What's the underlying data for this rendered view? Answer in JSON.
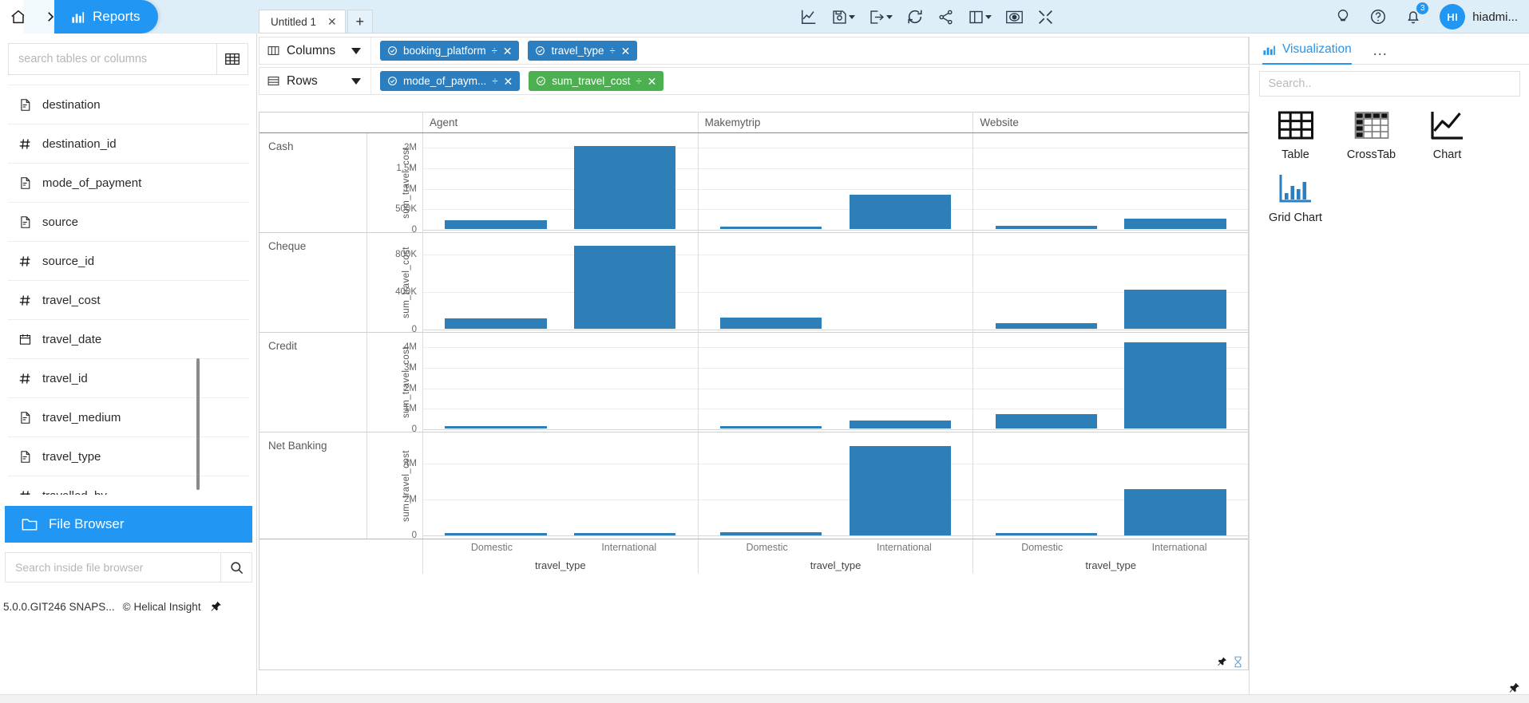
{
  "breadcrumb": {
    "home_icon": "home-icon",
    "separator": "chevron-right-icon",
    "active_icon": "bar-chart-icon",
    "active_label": "Reports"
  },
  "tabs": {
    "items": [
      {
        "label": "Untitled 1",
        "close": "✕"
      }
    ],
    "add_label": "+"
  },
  "toolbar": {
    "mid_icons": [
      {
        "name": "line-chart-icon",
        "caret": false
      },
      {
        "name": "save-icon",
        "caret": true
      },
      {
        "name": "export-icon",
        "caret": true
      },
      {
        "name": "refresh-icon",
        "caret": false
      },
      {
        "name": "share-icon",
        "caret": false
      },
      {
        "name": "layout-panel-icon",
        "caret": true
      },
      {
        "name": "preview-eye-icon",
        "caret": false
      },
      {
        "name": "fullscreen-icon",
        "caret": false
      }
    ],
    "lightbulb": "lightbulb-icon",
    "help": "help-icon",
    "bell": "bell-icon",
    "bell_badge": "3",
    "avatar_initials": "HI",
    "username": "hiadmi..."
  },
  "sidebar": {
    "search_placeholder": "search tables or columns",
    "grid_toggle_icon": "table-grid-icon",
    "fields": [
      {
        "label": "destination",
        "type": "text"
      },
      {
        "label": "destination_id",
        "type": "number"
      },
      {
        "label": "mode_of_payment",
        "type": "text"
      },
      {
        "label": "source",
        "type": "text"
      },
      {
        "label": "source_id",
        "type": "number"
      },
      {
        "label": "travel_cost",
        "type": "number"
      },
      {
        "label": "travel_date",
        "type": "date"
      },
      {
        "label": "travel_id",
        "type": "number"
      },
      {
        "label": "travel_medium",
        "type": "text"
      },
      {
        "label": "travel_type",
        "type": "text"
      },
      {
        "label": "travelled_by",
        "type": "number"
      }
    ],
    "file_browser_label": "File Browser",
    "file_browser_icon": "folder-icon",
    "fb_search_placeholder": "Search inside file browser",
    "fb_search_icon": "search-icon",
    "footer_version": "5.0.0.GIT246 SNAPS...",
    "footer_copyright": "Helical Insight",
    "footer_copyright_mark": "©",
    "footer_pin_icon": "pin-icon"
  },
  "shelves": [
    {
      "name": "columns-shelf",
      "icon": "columns-icon",
      "title": "Columns",
      "pills": [
        {
          "label": "booking_platform",
          "color": "blue"
        },
        {
          "label": "travel_type",
          "color": "blue"
        }
      ]
    },
    {
      "name": "rows-shelf",
      "icon": "rows-icon",
      "title": "Rows",
      "pills": [
        {
          "label": "mode_of_paym...",
          "color": "blue"
        },
        {
          "label": "sum_travel_cost",
          "color": "green"
        }
      ]
    }
  ],
  "pill_icons": {
    "check": "check-circle-icon",
    "sort": "÷",
    "close": "✕"
  },
  "right_panel": {
    "tab_label": "Visualization",
    "tab_icon": "chart-icon",
    "more_icon": "…",
    "search_placeholder": "Search..",
    "items": [
      {
        "label": "Table",
        "icon": "table-icon",
        "selected": false
      },
      {
        "label": "CrossTab",
        "icon": "crosstab-icon",
        "selected": false
      },
      {
        "label": "Chart",
        "icon": "line-chart-icon",
        "selected": false
      },
      {
        "label": "Grid Chart",
        "icon": "grid-chart-icon",
        "selected": true
      }
    ],
    "pin_icon": "pin-icon"
  },
  "chart_corner": {
    "pin_icon": "pin-icon",
    "loading_icon": "hourglass-icon"
  },
  "chart_data": {
    "type": "bar",
    "title": "",
    "layout": "small-multiples grid: rows = mode_of_payment, columns = booking_platform",
    "xlabel": "travel_type",
    "ylabel": "sum_travel_cost",
    "grid": true,
    "legend": "none",
    "bar_color": "#2e7fb8",
    "row_field": "mode_of_payment",
    "column_field": "booking_platform",
    "columns": [
      "Agent",
      "Makemytrip",
      "Website"
    ],
    "categories": [
      "Domestic",
      "International"
    ],
    "rows": [
      {
        "label": "Cash",
        "ylim": [
          0,
          2200000
        ],
        "yticks": [
          0,
          500000,
          1000000,
          1500000,
          2000000
        ],
        "ytick_labels": [
          "0",
          "500K",
          "1M",
          "1.5M",
          "2M"
        ],
        "panels": [
          {
            "column": "Agent",
            "values": [
              220000,
              2020000
            ]
          },
          {
            "column": "Makemytrip",
            "values": [
              20000,
              840000
            ]
          },
          {
            "column": "Website",
            "values": [
              80000,
              250000
            ]
          }
        ]
      },
      {
        "label": "Cheque",
        "ylim": [
          0,
          960000
        ],
        "yticks": [
          0,
          400000,
          800000
        ],
        "ytick_labels": [
          "0",
          "400K",
          "800K"
        ],
        "panels": [
          {
            "column": "Agent",
            "values": [
              110000,
              880000
            ]
          },
          {
            "column": "Makemytrip",
            "values": [
              115000,
              0
            ]
          },
          {
            "column": "Website",
            "values": [
              60000,
              420000
            ]
          }
        ]
      },
      {
        "label": "Credit",
        "ylim": [
          0,
          4400000
        ],
        "yticks": [
          0,
          1000000,
          2000000,
          3000000,
          4000000
        ],
        "ytick_labels": [
          "0",
          "1M",
          "2M",
          "3M",
          "4M"
        ],
        "panels": [
          {
            "column": "Agent",
            "values": [
              120000,
              0
            ]
          },
          {
            "column": "Makemytrip",
            "values": [
              100000,
              400000
            ]
          },
          {
            "column": "Website",
            "values": [
              700000,
              4200000
            ]
          }
        ]
      },
      {
        "label": "Net Banking",
        "ylim": [
          0,
          5400000
        ],
        "yticks": [
          0,
          2000000,
          4000000
        ],
        "ytick_labels": [
          "0",
          "2M",
          "4M"
        ],
        "panels": [
          {
            "column": "Agent",
            "values": [
              60000,
              70000
            ]
          },
          {
            "column": "Makemytrip",
            "values": [
              200000,
              5000000
            ]
          },
          {
            "column": "Website",
            "values": [
              90000,
              2600000
            ]
          }
        ]
      }
    ]
  }
}
